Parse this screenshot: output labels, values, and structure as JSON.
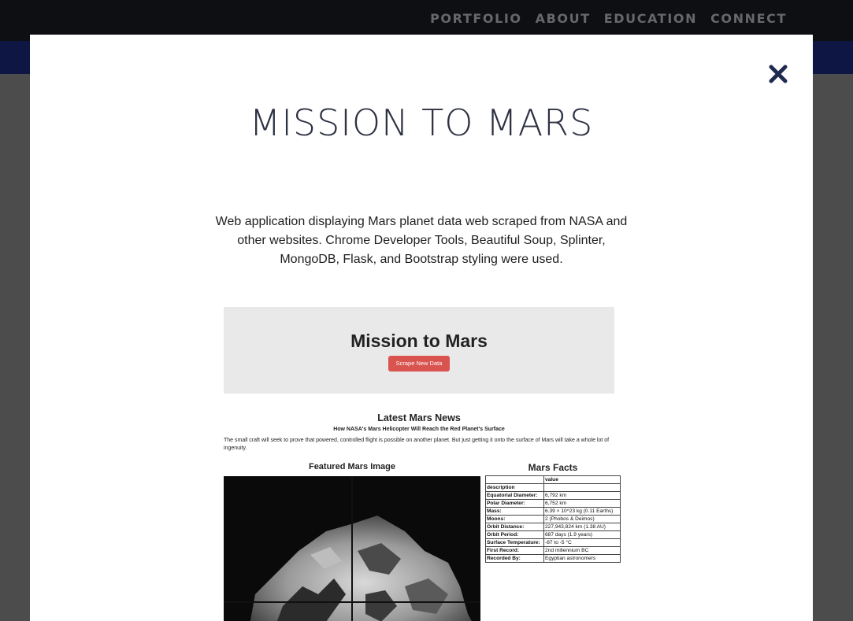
{
  "nav": {
    "links": [
      "PORTFOLIO",
      "ABOUT",
      "EDUCATION",
      "CONNECT"
    ]
  },
  "modal": {
    "title": "MISSION TO MARS",
    "description": "Web application displaying Mars planet data web scraped from NASA and other websites. Chrome Developer Tools, Beautiful Soup, Splinter, MongoDB, Flask, and Bootstrap styling were used.",
    "close_icon": "close-x-icon"
  },
  "screenshot": {
    "app_title": "Mission to Mars",
    "scrape_button": "Scrape New Data",
    "news_heading": "Latest Mars News",
    "news_title": "How NASA's Mars Helicopter Will Reach the Red Planet's Surface",
    "news_teaser": "The small craft will seek to prove that powered, controlled flight is possible on another planet. But just getting it onto the surface of Mars will take a whole lot of ingenuity.",
    "featured_heading": "Featured Mars Image",
    "facts_heading": "Mars Facts",
    "facts_header_value": "value",
    "facts_header_desc": "description",
    "facts": [
      {
        "k": "Equatorial Diameter:",
        "v": "6,792 km"
      },
      {
        "k": "Polar Diameter:",
        "v": "6,752 km"
      },
      {
        "k": "Mass:",
        "v": "6.39 × 10^23 kg (0.11 Earths)"
      },
      {
        "k": "Moons:",
        "v": "2 (Phobos & Deimos)"
      },
      {
        "k": "Orbit Distance:",
        "v": "227,943,824 km (1.38 AU)"
      },
      {
        "k": "Orbit Period:",
        "v": "687 days (1.9 years)"
      },
      {
        "k": "Surface Temperature:",
        "v": "-87 to -5 °C"
      },
      {
        "k": "First Record:",
        "v": "2nd millennium BC"
      },
      {
        "k": "Recorded By:",
        "v": "Egyptian astronomers"
      }
    ]
  },
  "colors": {
    "nav_bg": "#1a1d24",
    "subbar": "#1b2a7a",
    "close_x": "#1f2a4f",
    "button_red": "#d9534f"
  }
}
